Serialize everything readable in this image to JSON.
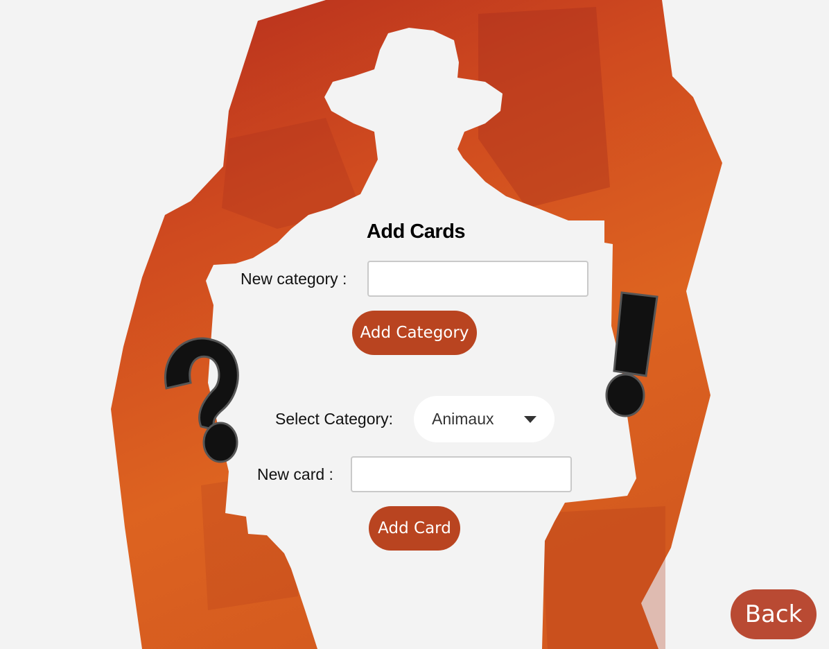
{
  "page": {
    "title": "Add Cards"
  },
  "category_form": {
    "label": "New category :",
    "value": "",
    "button_label": "Add Category"
  },
  "card_form": {
    "select_label": "Select Category:",
    "selected_category": "Animaux",
    "new_card_label": "New card :",
    "value": "",
    "button_label": "Add Card"
  },
  "nav": {
    "back_label": "Back"
  },
  "icons": [
    "question-mark-icon",
    "exclamation-mark-icon",
    "chevron-down-icon"
  ],
  "colors": {
    "background": "#f3f3f3",
    "accent_button": "#b94420",
    "back_button": "#b94a33",
    "artwork_orange": "#dd6020",
    "artwork_red": "#b8301f"
  }
}
